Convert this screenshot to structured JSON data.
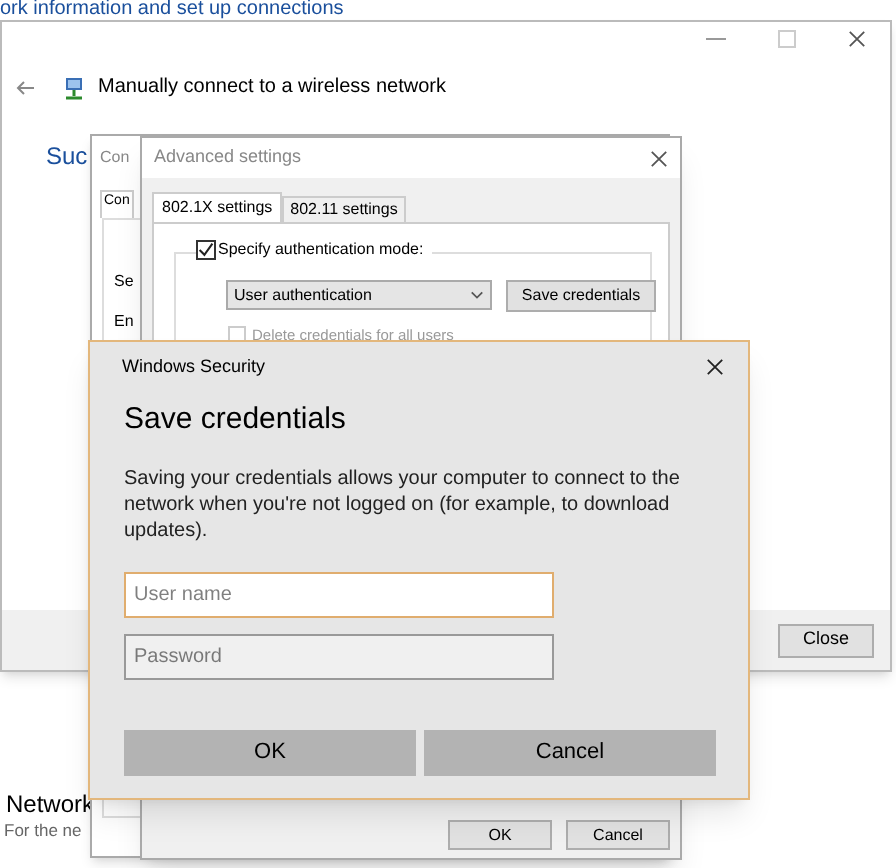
{
  "background_page": {
    "header_text": "ork information and set up connections",
    "section_title": "Network",
    "section_text": "For the ne"
  },
  "wizard": {
    "title": "Manually connect to a wireless network",
    "heading": "Suc",
    "buttons": [
      "Close"
    ]
  },
  "connection_properties": {
    "title": "Con",
    "tabs": [
      {
        "label": "Con",
        "selected": true
      }
    ],
    "labels": [
      "Se",
      "En"
    ]
  },
  "advanced_settings": {
    "title": "Advanced settings",
    "tabs": [
      {
        "label": "802.1X settings",
        "selected": true
      },
      {
        "label": "802.11 settings",
        "selected": false
      }
    ],
    "specify_auth": {
      "label": "Specify authentication mode:",
      "checked": true
    },
    "auth_mode": {
      "value": "User authentication"
    },
    "save_button": "Save credentials",
    "delete_credentials": {
      "label": "Delete credentials for all users",
      "checked": false,
      "disabled": true
    },
    "buttons": [
      "OK",
      "Cancel"
    ]
  },
  "security_dialog": {
    "window_title": "Windows Security",
    "heading": "Save credentials",
    "message": "Saving your credentials allows your computer to connect to the network when you're not logged on (for example, to download updates).",
    "fields": [
      {
        "placeholder": "User name",
        "focused": true
      },
      {
        "placeholder": "Password",
        "focused": false
      }
    ],
    "buttons": [
      "OK",
      "Cancel"
    ]
  }
}
